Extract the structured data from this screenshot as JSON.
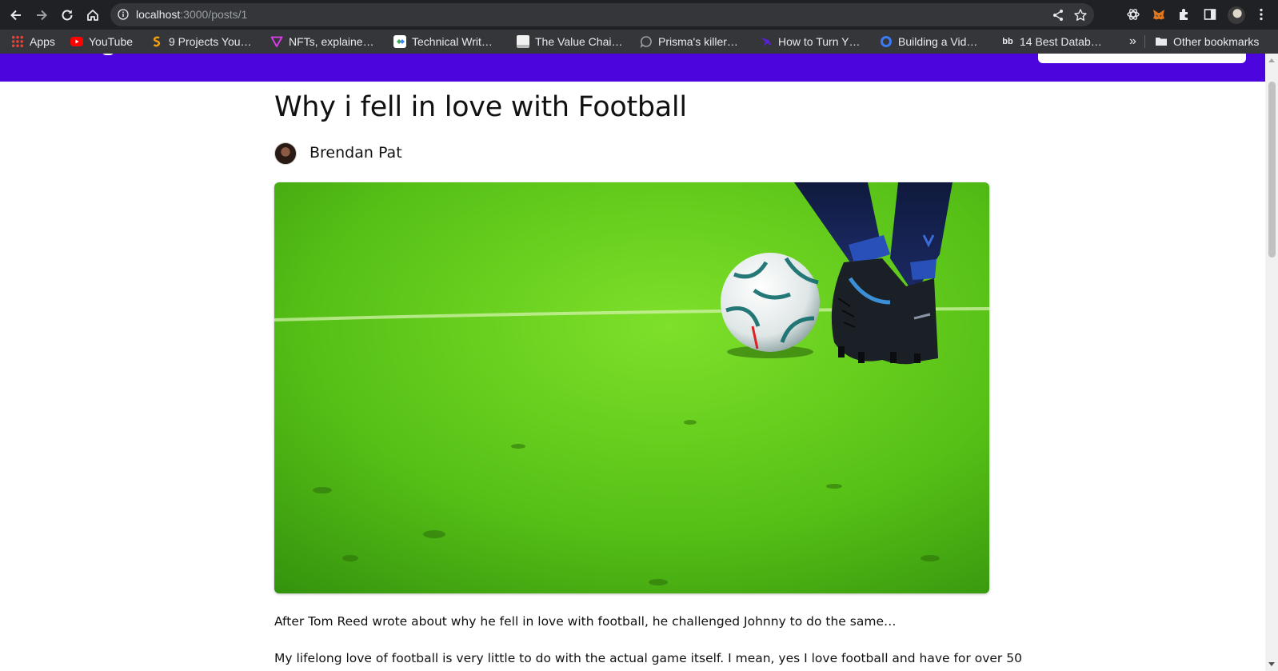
{
  "browser": {
    "url_host": "localhost",
    "url_path": ":3000/posts/1",
    "bookmarks": [
      {
        "label": "Apps",
        "icon": "apps-grid-icon"
      },
      {
        "label": "YouTube",
        "icon": "youtube-icon"
      },
      {
        "label": "9 Projects You…",
        "icon": "orange-s-icon"
      },
      {
        "label": "NFTs, explaine…",
        "icon": "verge-icon"
      },
      {
        "label": "Technical Writ…",
        "icon": "doc-icon"
      },
      {
        "label": "The Value Chai…",
        "icon": "page-icon"
      },
      {
        "label": "Prisma's killer…",
        "icon": "chat-bubble-icon"
      },
      {
        "label": "How to Turn Y…",
        "icon": "purple-bird-icon"
      },
      {
        "label": "Building a Vid…",
        "icon": "blue-ring-icon"
      },
      {
        "label": "14 Best Datab…",
        "icon": "bb-icon"
      }
    ],
    "more_bookmarks": "»",
    "other_bookmarks": "Other bookmarks"
  },
  "post": {
    "title": "Why i fell in love with Football",
    "author": "Brendan Pat",
    "image_alt": "Football on green grass pitch",
    "paragraph_1": "After Tom Reed wrote about why he fell in love with football, he challenged Johnny to do the same…",
    "paragraph_2": "My lifelong love of football is very little to do with the actual game itself. I mean, yes I love football and have for over 50"
  },
  "colors": {
    "header": "#4d05dd",
    "grass": "#5ec718",
    "chrome_dark": "#202124",
    "chrome_bar": "#35363a"
  }
}
